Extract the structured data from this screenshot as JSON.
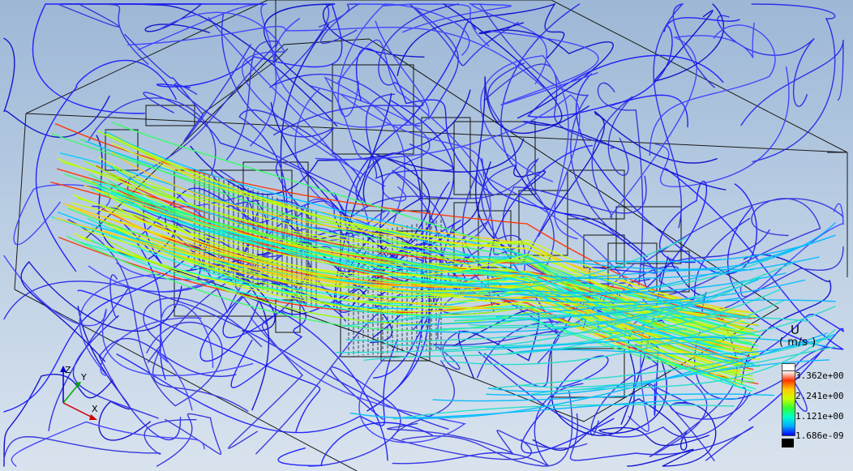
{
  "legend": {
    "title": "U",
    "unit": "( m/s )",
    "ticks": [
      "3.362e+00",
      "2.241e+00",
      "1.121e+00",
      "1.686e-09"
    ]
  },
  "axes": {
    "x": "X",
    "y": "Y",
    "z": "Z"
  },
  "colors": {
    "background_top": "#9db7d6",
    "background_bottom": "#d9e3ee",
    "colormap": [
      "#0000ff",
      "#00aaff",
      "#00ffcc",
      "#33ff33",
      "#ccff00",
      "#ffcc00",
      "#ff3300",
      "#ffffff"
    ]
  }
}
